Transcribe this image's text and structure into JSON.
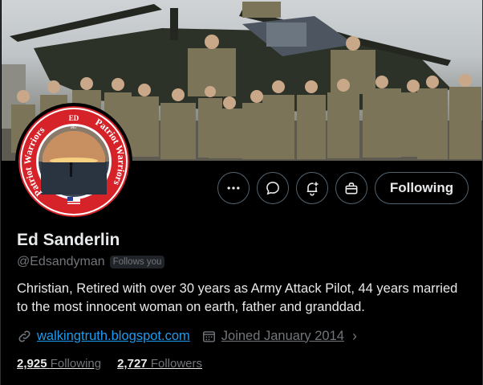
{
  "profile": {
    "name": "Ed Sanderlin",
    "handle": "@Edsandyman",
    "follows_you": "Follows you",
    "bio": "Christian, Retired with over 30 years as Army Attack Pilot, 44 years married to the most innocent woman on earth, father and granddad.",
    "website": "walkingtruth.blogspot.com",
    "joined": "Joined January 2014"
  },
  "stats": {
    "following_count": "2,925",
    "following_label": "Following",
    "followers_count": "2,727",
    "followers_label": "Followers"
  },
  "actions": {
    "follow_label": "Following",
    "more_icon": "more-icon",
    "message_icon": "message-icon",
    "notify_icon": "notification-bell-icon",
    "subscribe_icon": "gift-icon"
  },
  "avatar": {
    "top_text": "ED",
    "left_text": "Patriot Warriors",
    "right_text": "Patriot Warriors",
    "number": "967"
  },
  "colors": {
    "link": "#1d9bf0",
    "muted": "#71767b",
    "border": "#536471",
    "avatar_ring": "#d6232a"
  }
}
